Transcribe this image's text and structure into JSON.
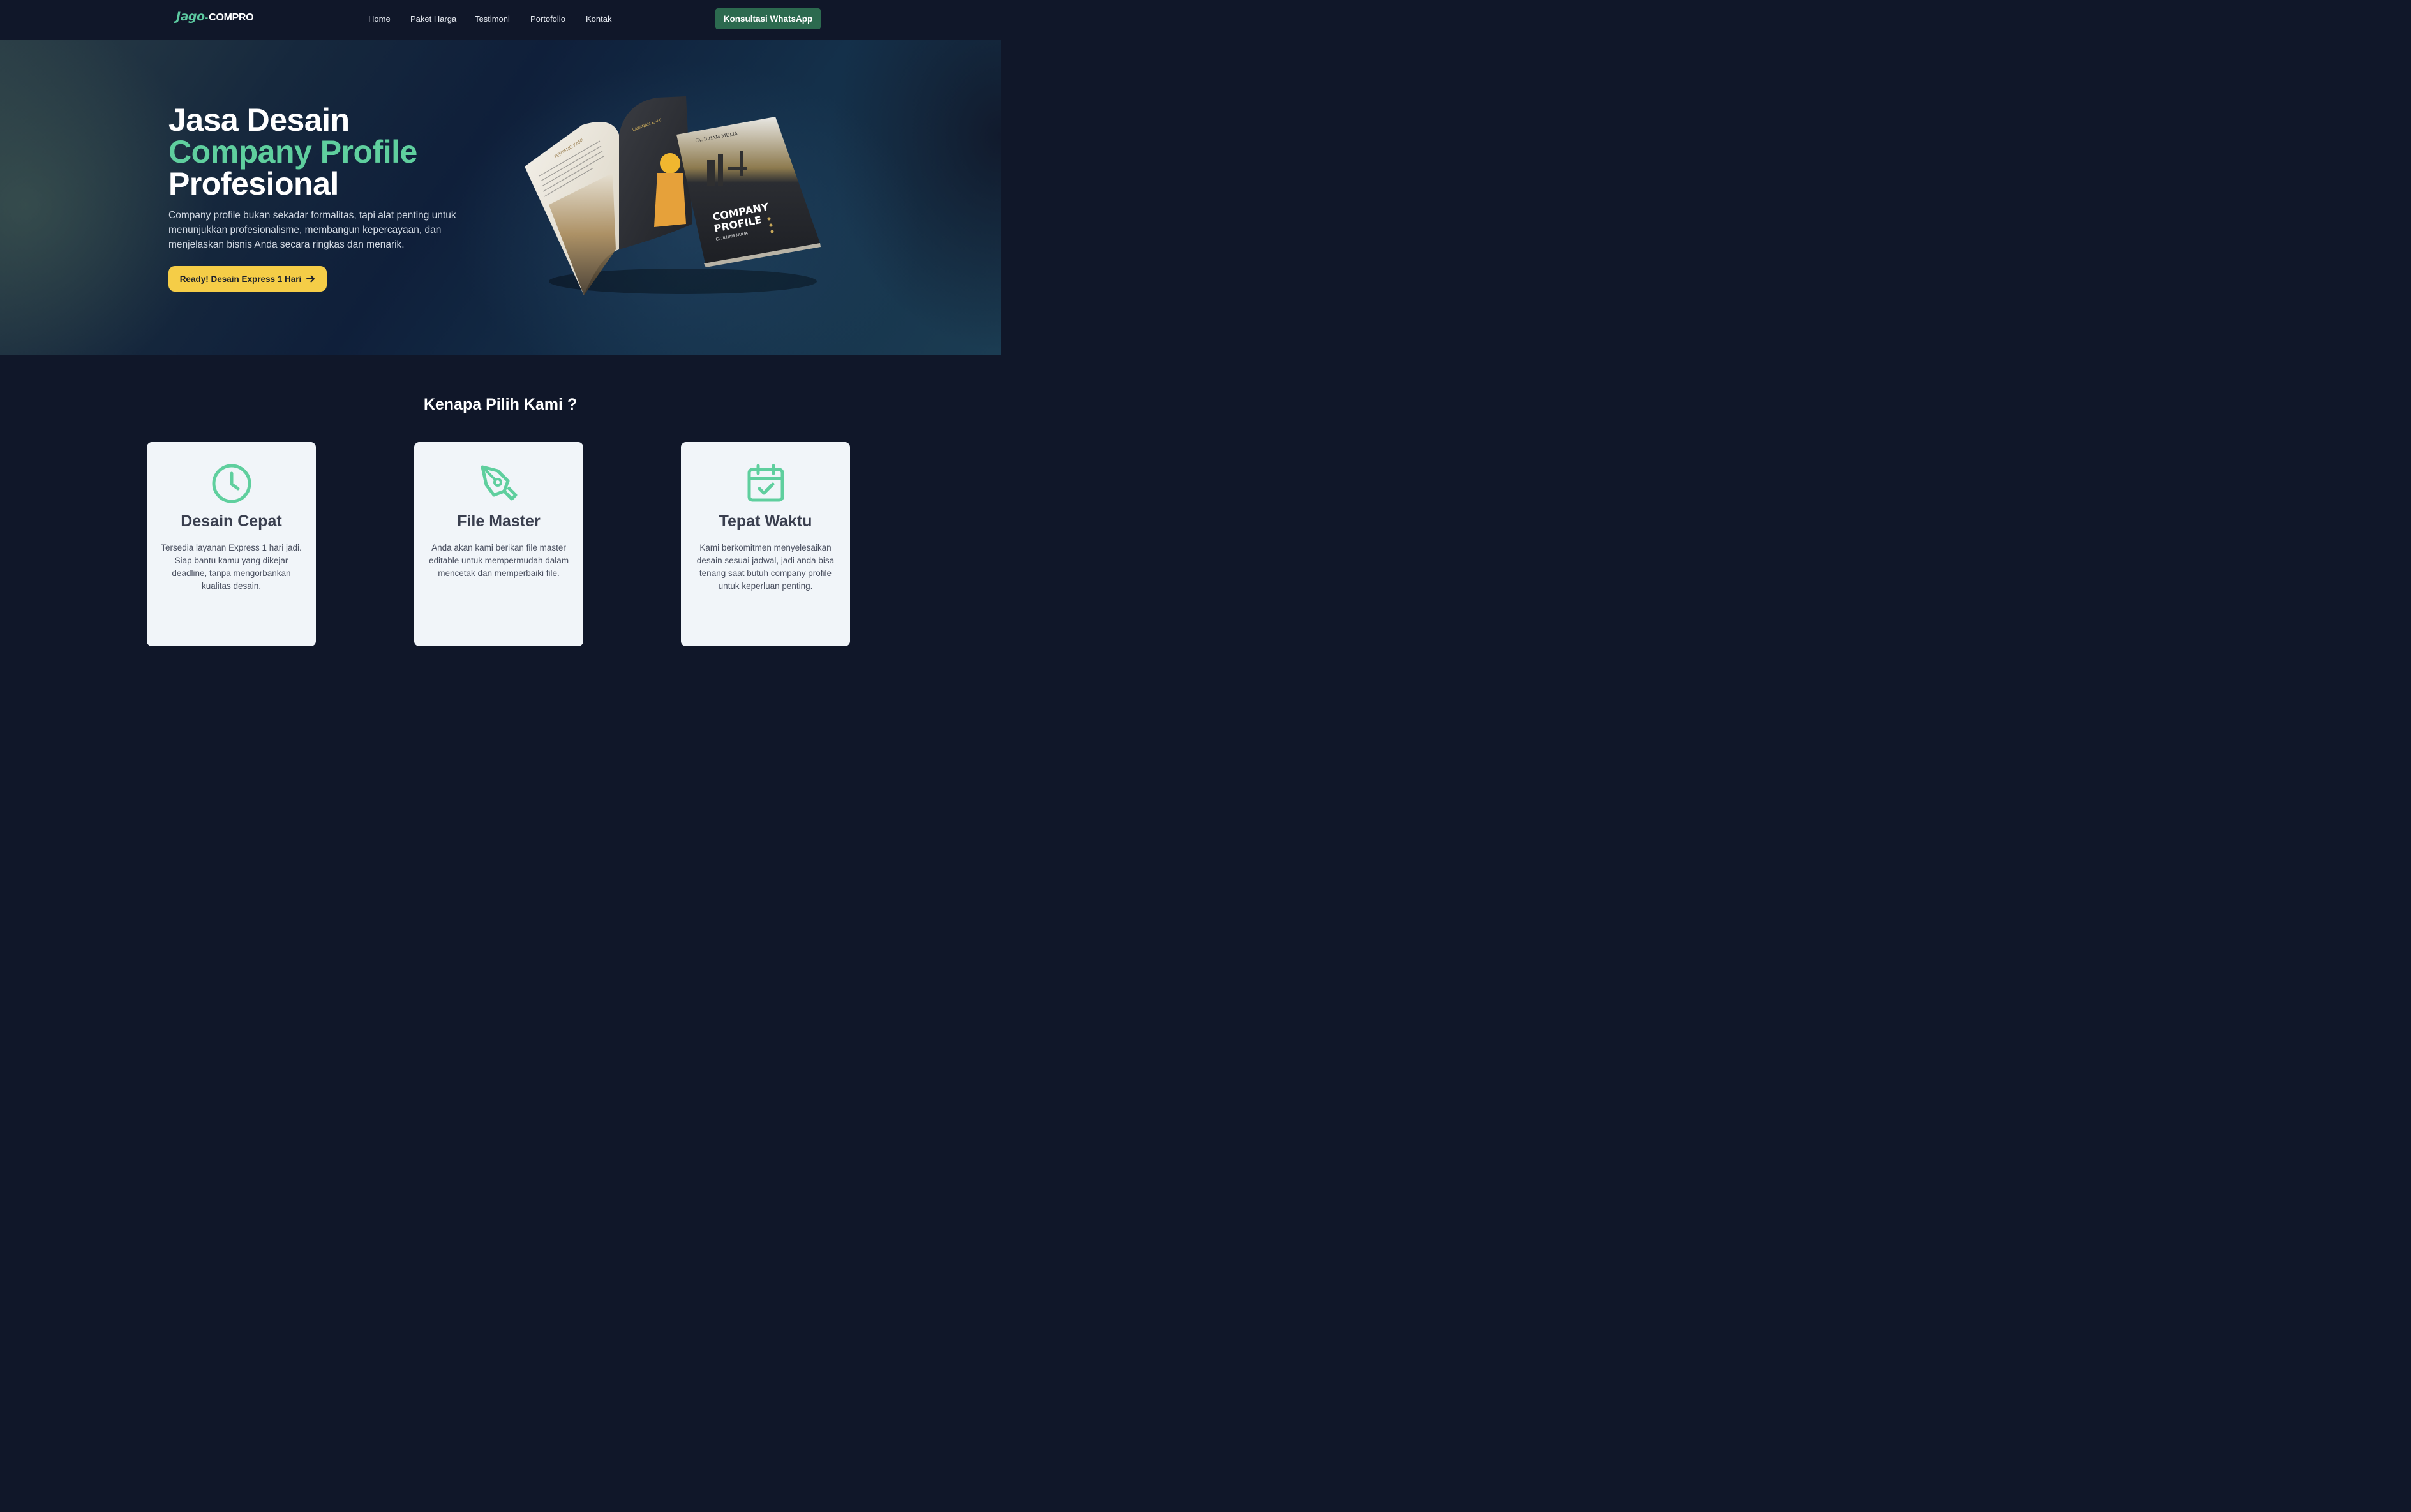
{
  "brand": {
    "logo_part1": "Jago",
    "logo_part2": "COMPRO"
  },
  "nav": {
    "links": [
      "Home",
      "Paket Harga",
      "Testimoni",
      "Portofolio",
      "Kontak"
    ],
    "cta": "Konsultasi WhatsApp"
  },
  "hero": {
    "title_line1": "Jasa Desain",
    "title_line2": "Company Profile",
    "title_line3": "Profesional",
    "description": "Company profile bukan sekadar formalitas, tapi alat penting untuk menunjukkan profesionalisme, membangun kepercayaan, dan menjelaskan bisnis Anda secara ringkas dan menarik.",
    "button": "Ready! Desain Express 1 Hari",
    "mockup": {
      "cover_company": "CV. ILHAM MULIA",
      "cover_title_1": "COMPANY",
      "cover_title_2": "PROFILE",
      "cover_subtitle": "CV. ILHAM MULIA",
      "page_left_heading": "TENTANG KAMI",
      "page_right_heading": "LAYANAN KAMI"
    }
  },
  "features": {
    "title": "Kenapa Pilih Kami ?",
    "cards": [
      {
        "icon": "clock-icon",
        "title": "Desain Cepat",
        "text": "Tersedia layanan Express 1 hari jadi. Siap bantu kamu yang dikejar deadline, tanpa mengorbankan kualitas desain."
      },
      {
        "icon": "pen-tool-icon",
        "title": "File Master",
        "text": "Anda akan kami berikan file master editable untuk mempermudah dalam mencetak dan memperbaiki file."
      },
      {
        "icon": "calendar-check-icon",
        "title": "Tepat Waktu",
        "text": "Kami berkomitmen menyelesaikan desain sesuai jadwal, jadi anda bisa tenang saat butuh company profile untuk keperluan penting."
      }
    ]
  },
  "colors": {
    "accent": "#5fcf9e",
    "cta_green": "#2c6a4f",
    "cta_yellow": "#f5cd47",
    "background": "#101729",
    "card": "#f1f5f9"
  }
}
